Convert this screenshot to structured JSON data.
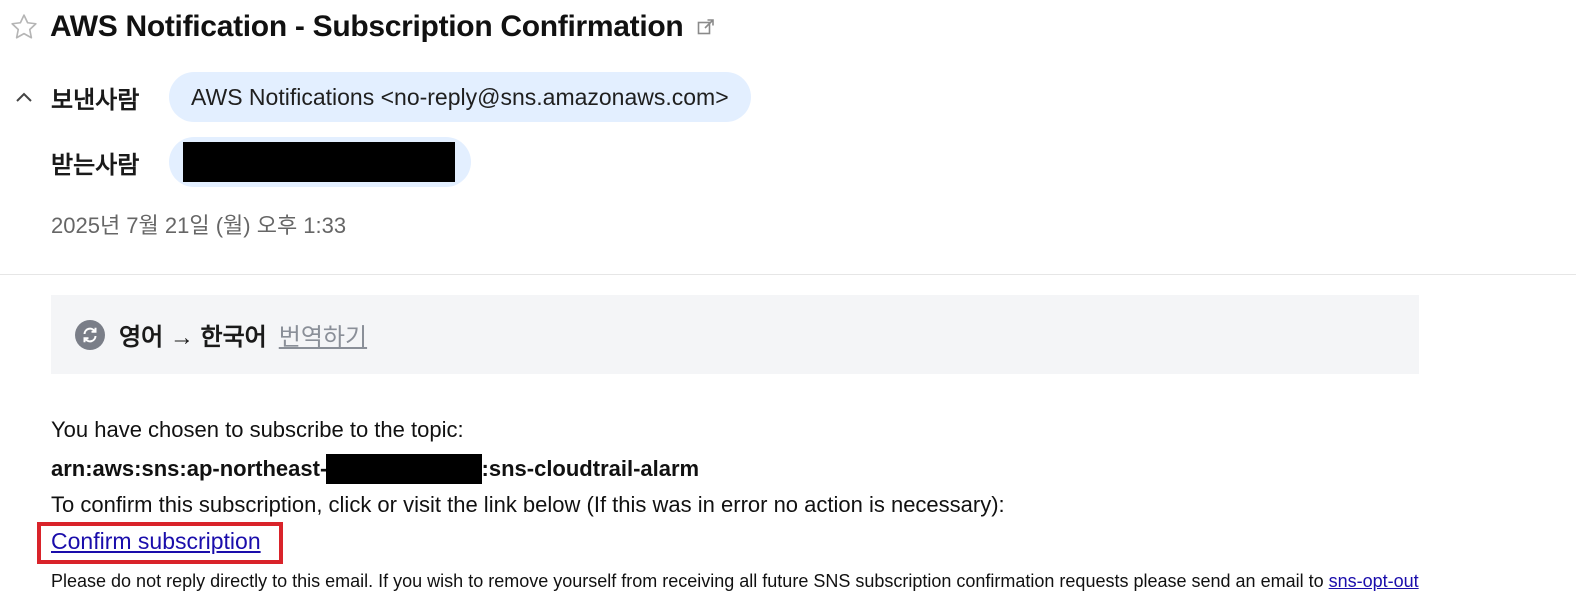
{
  "email": {
    "subject": "AWS Notification - Subscription Confirmation",
    "sender_label": "보낸사람",
    "sender": "AWS Notifications <no-reply@sns.amazonaws.com>",
    "recipient_label": "받는사람",
    "date": "2025년 7월 21일 (월) 오후 1:33"
  },
  "translate": {
    "languages": "영어 → 한국어",
    "action": "번역하기"
  },
  "body": {
    "line1": "You have chosen to subscribe to the topic:",
    "arn_prefix": "arn:aws:sns:ap-northeast-2",
    "arn_suffix": ":sns-cloudtrail-alarm",
    "line3": "To confirm this subscription, click or visit the link below (If this was in error no action is necessary):",
    "confirm_link": "Confirm subscription",
    "footer": "Please do not reply directly to this email. If you wish to remove yourself from receiving all future SNS subscription confirmation requests please send an email to ",
    "footer_link": "sns-opt-out"
  },
  "colors": {
    "chip_bg": "#e3efff",
    "link": "#1a0dab",
    "highlight_border": "#d9232a",
    "translate_bar_bg": "#f4f5f7"
  },
  "icons": {
    "star": "star-icon",
    "popout": "external-link-icon",
    "collapse": "chevron-up-icon",
    "translate": "translate-refresh-icon"
  }
}
